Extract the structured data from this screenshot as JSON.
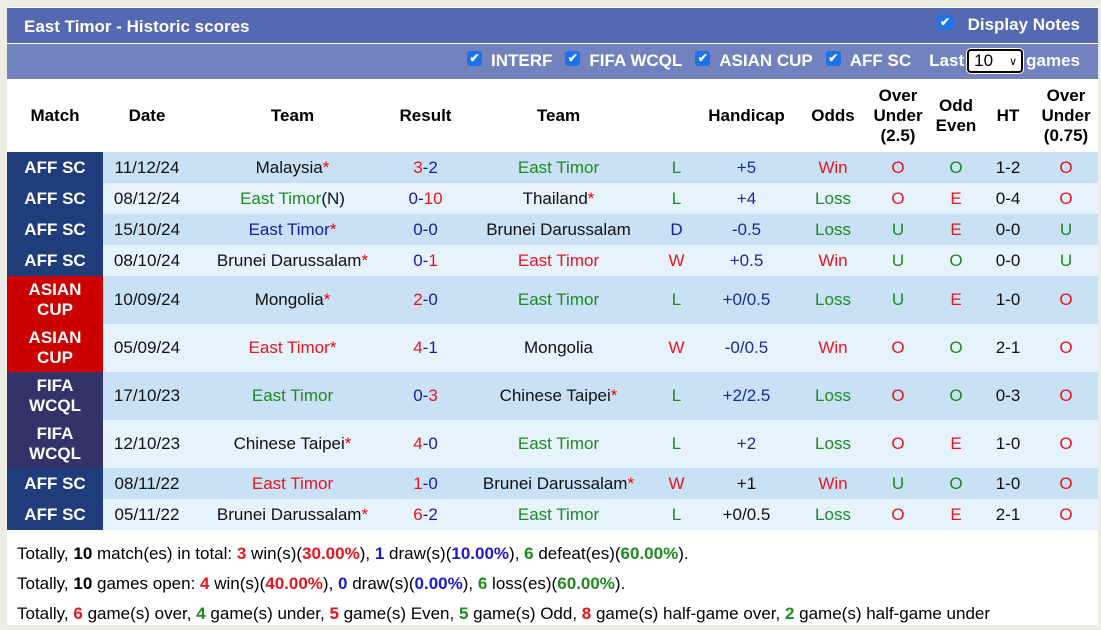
{
  "header": {
    "title": "East Timor - Historic scores",
    "display_notes_label": "Display Notes",
    "display_notes_checked": true
  },
  "filters": {
    "items": [
      {
        "label": "INTERF",
        "checked": true
      },
      {
        "label": "FIFA WCQL",
        "checked": true
      },
      {
        "label": "ASIAN CUP",
        "checked": true
      },
      {
        "label": "AFF SC",
        "checked": true
      }
    ],
    "last_label": "Last",
    "games_value": "10",
    "games_label": "games"
  },
  "columns": {
    "match": "Match",
    "date": "Date",
    "team_home": "Team",
    "result": "Result",
    "team_away": "Team",
    "result_wl": "",
    "handicap": "Handicap",
    "odds": "Odds",
    "ou_line1": "Over",
    "ou_line2": "Under",
    "ou_line3": "(2.5)",
    "oe_line1": "Odd",
    "oe_line2": "Even",
    "ht": "HT",
    "ou2_line1": "Over",
    "ou2_line2": "Under",
    "ou2_line3": "(0.75)"
  },
  "rows": [
    {
      "match": "AFF SC",
      "match_type": "aff",
      "date": "11/12/24",
      "home": "Malaysia",
      "home_star": "*",
      "home_color": "black",
      "home_suffix": "",
      "score_home": "3",
      "score_home_color": "red",
      "score_away": "2",
      "score_away_color": "blue",
      "away": "East Timor",
      "away_star": "",
      "away_color": "green",
      "wl": "L",
      "wl_color": "green",
      "handicap": "+5",
      "handicap_color": "navy",
      "odds": "Win",
      "odds_color": "red",
      "ou": "O",
      "ou_color": "red",
      "oe": "O",
      "oe_color": "green",
      "ht": "1-2",
      "ou2": "O",
      "ou2_color": "red"
    },
    {
      "match": "AFF SC",
      "match_type": "aff",
      "date": "08/12/24",
      "home": "East Timor",
      "home_star": "",
      "home_color": "green",
      "home_suffix": "(N)",
      "score_home": "0",
      "score_home_color": "blue",
      "score_away": "10",
      "score_away_color": "red",
      "away": "Thailand",
      "away_star": "*",
      "away_color": "black",
      "wl": "L",
      "wl_color": "green",
      "handicap": "+4",
      "handicap_color": "navy",
      "odds": "Loss",
      "odds_color": "green",
      "ou": "O",
      "ou_color": "red",
      "oe": "E",
      "oe_color": "red",
      "ht": "0-4",
      "ou2": "O",
      "ou2_color": "red"
    },
    {
      "match": "AFF SC",
      "match_type": "aff",
      "date": "15/10/24",
      "home": "East Timor",
      "home_star": "*",
      "home_color": "blue",
      "home_suffix": "",
      "score_home": "0",
      "score_home_color": "blue",
      "score_away": "0",
      "score_away_color": "blue",
      "away": "Brunei Darussalam",
      "away_star": "",
      "away_color": "black",
      "wl": "D",
      "wl_color": "blue",
      "handicap": "-0.5",
      "handicap_color": "navy",
      "odds": "Loss",
      "odds_color": "green",
      "ou": "U",
      "ou_color": "green",
      "oe": "E",
      "oe_color": "red",
      "ht": "0-0",
      "ou2": "U",
      "ou2_color": "green"
    },
    {
      "match": "AFF SC",
      "match_type": "aff",
      "date": "08/10/24",
      "home": "Brunei Darussalam",
      "home_star": "*",
      "home_color": "black",
      "home_suffix": "",
      "score_home": "0",
      "score_home_color": "blue",
      "score_away": "1",
      "score_away_color": "red",
      "away": "East Timor",
      "away_star": "",
      "away_color": "red",
      "wl": "W",
      "wl_color": "red",
      "handicap": "+0.5",
      "handicap_color": "navy",
      "odds": "Win",
      "odds_color": "red",
      "ou": "U",
      "ou_color": "green",
      "oe": "O",
      "oe_color": "green",
      "ht": "0-0",
      "ou2": "U",
      "ou2_color": "green"
    },
    {
      "match": "ASIAN CUP",
      "match_type": "asian",
      "date": "10/09/24",
      "home": "Mongolia",
      "home_star": "*",
      "home_color": "black",
      "home_suffix": "",
      "score_home": "2",
      "score_home_color": "red",
      "score_away": "0",
      "score_away_color": "blue",
      "away": "East Timor",
      "away_star": "",
      "away_color": "green",
      "wl": "L",
      "wl_color": "green",
      "handicap": "+0/0.5",
      "handicap_color": "navy",
      "odds": "Loss",
      "odds_color": "green",
      "ou": "U",
      "ou_color": "green",
      "oe": "E",
      "oe_color": "red",
      "ht": "1-0",
      "ou2": "O",
      "ou2_color": "red"
    },
    {
      "match": "ASIAN CUP",
      "match_type": "asian",
      "date": "05/09/24",
      "home": "East Timor",
      "home_star": "*",
      "home_color": "red",
      "home_suffix": "",
      "score_home": "4",
      "score_home_color": "red",
      "score_away": "1",
      "score_away_color": "blue",
      "away": "Mongolia",
      "away_star": "",
      "away_color": "black",
      "wl": "W",
      "wl_color": "red",
      "handicap": "-0/0.5",
      "handicap_color": "navy",
      "odds": "Win",
      "odds_color": "red",
      "ou": "O",
      "ou_color": "red",
      "oe": "O",
      "oe_color": "green",
      "ht": "2-1",
      "ou2": "O",
      "ou2_color": "red"
    },
    {
      "match": "FIFA WCQL",
      "match_type": "fifa",
      "date": "17/10/23",
      "home": "East Timor",
      "home_star": "",
      "home_color": "green",
      "home_suffix": "",
      "score_home": "0",
      "score_home_color": "blue",
      "score_away": "3",
      "score_away_color": "red",
      "away": "Chinese Taipei",
      "away_star": "*",
      "away_color": "black",
      "wl": "L",
      "wl_color": "green",
      "handicap": "+2/2.5",
      "handicap_color": "navy",
      "odds": "Loss",
      "odds_color": "green",
      "ou": "O",
      "ou_color": "red",
      "oe": "O",
      "oe_color": "green",
      "ht": "0-3",
      "ou2": "O",
      "ou2_color": "red"
    },
    {
      "match": "FIFA WCQL",
      "match_type": "fifa",
      "date": "12/10/23",
      "home": "Chinese Taipei",
      "home_star": "*",
      "home_color": "black",
      "home_suffix": "",
      "score_home": "4",
      "score_home_color": "red",
      "score_away": "0",
      "score_away_color": "blue",
      "away": "East Timor",
      "away_star": "",
      "away_color": "green",
      "wl": "L",
      "wl_color": "green",
      "handicap": "+2",
      "handicap_color": "navy",
      "odds": "Loss",
      "odds_color": "green",
      "ou": "O",
      "ou_color": "red",
      "oe": "E",
      "oe_color": "red",
      "ht": "1-0",
      "ou2": "O",
      "ou2_color": "red"
    },
    {
      "match": "AFF SC",
      "match_type": "aff",
      "date": "08/11/22",
      "home": "East Timor",
      "home_star": "",
      "home_color": "red",
      "home_suffix": "",
      "score_home": "1",
      "score_home_color": "red",
      "score_away": "0",
      "score_away_color": "blue",
      "away": "Brunei Darussalam",
      "away_star": "*",
      "away_color": "black",
      "wl": "W",
      "wl_color": "red",
      "handicap": "+1",
      "handicap_color": "black",
      "odds": "Win",
      "odds_color": "red",
      "ou": "U",
      "ou_color": "green",
      "oe": "O",
      "oe_color": "green",
      "ht": "1-0",
      "ou2": "O",
      "ou2_color": "red"
    },
    {
      "match": "AFF SC",
      "match_type": "aff",
      "date": "05/11/22",
      "home": "Brunei Darussalam",
      "home_star": "*",
      "home_color": "black",
      "home_suffix": "",
      "score_home": "6",
      "score_home_color": "red",
      "score_away": "2",
      "score_away_color": "blue",
      "away": "East Timor",
      "away_star": "",
      "away_color": "green",
      "wl": "L",
      "wl_color": "green",
      "handicap": "+0/0.5",
      "handicap_color": "black",
      "odds": "Loss",
      "odds_color": "green",
      "ou": "O",
      "ou_color": "red",
      "oe": "E",
      "oe_color": "red",
      "ht": "2-1",
      "ou2": "O",
      "ou2_color": "red"
    }
  ],
  "summary": {
    "line1": [
      {
        "t": "Totally, ",
        "c": "plain"
      },
      {
        "t": "10",
        "c": "bold"
      },
      {
        "t": " match(es) in total: ",
        "c": "plain"
      },
      {
        "t": "3",
        "c": "red"
      },
      {
        "t": " win(s)(",
        "c": "plain"
      },
      {
        "t": "30.00%",
        "c": "red"
      },
      {
        "t": "), ",
        "c": "plain"
      },
      {
        "t": "1",
        "c": "blue"
      },
      {
        "t": " draw(s)(",
        "c": "plain"
      },
      {
        "t": "10.00%",
        "c": "blue"
      },
      {
        "t": "), ",
        "c": "plain"
      },
      {
        "t": "6",
        "c": "green"
      },
      {
        "t": " defeat(es)(",
        "c": "plain"
      },
      {
        "t": "60.00%",
        "c": "green"
      },
      {
        "t": ").",
        "c": "plain"
      }
    ],
    "line2": [
      {
        "t": "Totally, ",
        "c": "plain"
      },
      {
        "t": "10",
        "c": "bold"
      },
      {
        "t": " games open: ",
        "c": "plain"
      },
      {
        "t": "4",
        "c": "red"
      },
      {
        "t": " win(s)(",
        "c": "plain"
      },
      {
        "t": "40.00%",
        "c": "red"
      },
      {
        "t": "), ",
        "c": "plain"
      },
      {
        "t": "0",
        "c": "blue"
      },
      {
        "t": " draw(s)(",
        "c": "plain"
      },
      {
        "t": "0.00%",
        "c": "blue"
      },
      {
        "t": "), ",
        "c": "plain"
      },
      {
        "t": "6",
        "c": "green"
      },
      {
        "t": " loss(es)(",
        "c": "plain"
      },
      {
        "t": "60.00%",
        "c": "green"
      },
      {
        "t": ").",
        "c": "plain"
      }
    ],
    "line3": [
      {
        "t": "Totally, ",
        "c": "plain"
      },
      {
        "t": "6",
        "c": "red"
      },
      {
        "t": " game(s) over, ",
        "c": "plain"
      },
      {
        "t": "4",
        "c": "green"
      },
      {
        "t": " game(s) under, ",
        "c": "plain"
      },
      {
        "t": "5",
        "c": "red"
      },
      {
        "t": " game(s) Even, ",
        "c": "plain"
      },
      {
        "t": "5",
        "c": "green"
      },
      {
        "t": " game(s) Odd, ",
        "c": "plain"
      },
      {
        "t": "8",
        "c": "red"
      },
      {
        "t": " game(s) half-game over, ",
        "c": "plain"
      },
      {
        "t": "2",
        "c": "green"
      },
      {
        "t": " game(s) half-game under",
        "c": "plain"
      }
    ]
  }
}
